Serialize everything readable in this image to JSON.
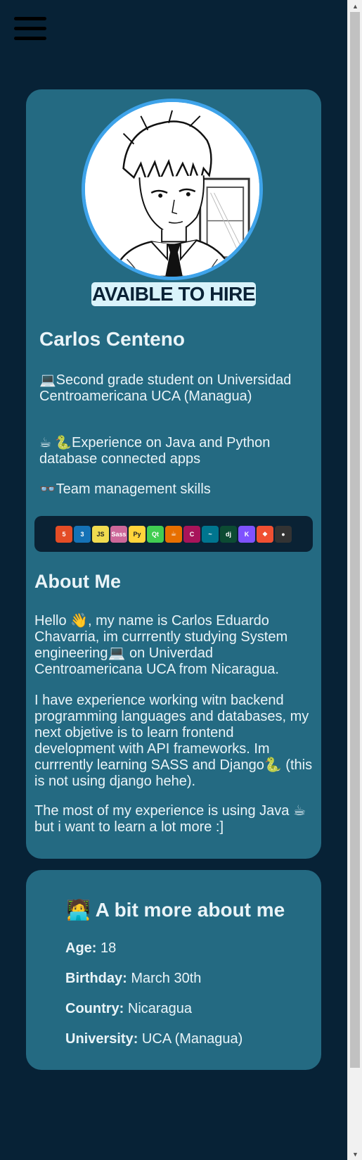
{
  "profile": {
    "hire_badge": "AVAIBLE TO HIRE",
    "name": "Carlos Centeno",
    "facts": [
      {
        "emoji": "💻",
        "text": "Second grade student on Universidad Centroamericana UCA (Managua)"
      },
      {
        "emoji": "☕ 🐍",
        "text": "Experience on Java and Python database connected apps"
      },
      {
        "emoji": "👓",
        "text": "Team management skills"
      }
    ],
    "tech_icons": [
      {
        "name": "html5-icon",
        "label": "5",
        "color": "#e44d26"
      },
      {
        "name": "css3-icon",
        "label": "3",
        "color": "#1572b6"
      },
      {
        "name": "javascript-icon",
        "label": "JS",
        "color": "#f0db4f"
      },
      {
        "name": "sass-icon",
        "label": "Sass",
        "color": "#cd6799"
      },
      {
        "name": "python-icon",
        "label": "Py",
        "color": "#ffd43b"
      },
      {
        "name": "qt-icon",
        "label": "Qt",
        "color": "#41cd52"
      },
      {
        "name": "java-icon",
        "label": "☕",
        "color": "#e76f00"
      },
      {
        "name": "c-icon",
        "label": "C",
        "color": "#a8145a"
      },
      {
        "name": "mysql-icon",
        "label": "~",
        "color": "#00758f"
      },
      {
        "name": "django-icon",
        "label": "dj",
        "color": "#0c4b33"
      },
      {
        "name": "kotlin-icon",
        "label": "K",
        "color": "#7f52ff"
      },
      {
        "name": "git-icon",
        "label": "◆",
        "color": "#f05032"
      },
      {
        "name": "github-icon",
        "label": "●",
        "color": "#333333"
      }
    ]
  },
  "about": {
    "title": "About Me",
    "paragraphs": [
      "Hello 👋, my name is Carlos Eduardo Chavarria, im currrently studying System engineering💻 on Univerdad Centroamericana UCA from Nicaragua.",
      "I have experience working witn backend programming languages and databases, my next objetive is to learn frontend development with API frameworks. Im currrently learning SASS and Django🐍 (this is not using django hehe).",
      "The most of my experience is using Java ☕ but i want to learn a lot more :]"
    ]
  },
  "more": {
    "title": "🧑‍💻 A bit more about me",
    "rows": [
      {
        "label": "Age:",
        "value": " 18"
      },
      {
        "label": "Birthday:",
        "value": " March 30th"
      },
      {
        "label": "Country:",
        "value": " Nicaragua"
      },
      {
        "label": "University:",
        "value": " UCA (Managua)"
      }
    ]
  }
}
